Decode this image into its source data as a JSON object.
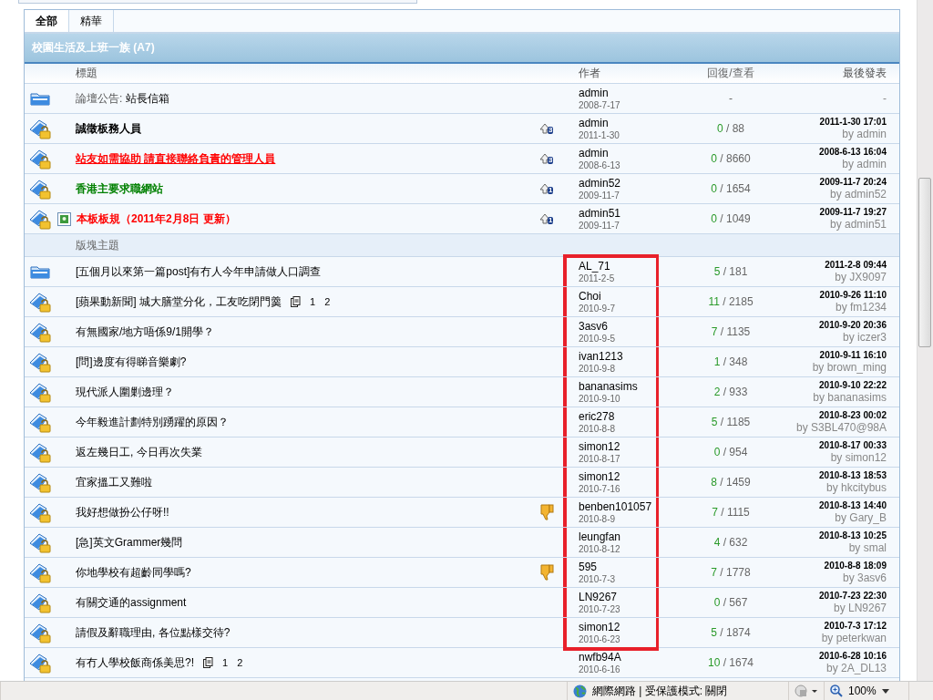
{
  "tabs": [
    {
      "label": "全部",
      "selected": true
    },
    {
      "label": "精華",
      "selected": false
    }
  ],
  "forum_title": "校園生活及上班一族 (A7)",
  "columns": {
    "title": "標題",
    "author": "作者",
    "replies": "回復/查看",
    "last_post": "最後發表"
  },
  "sticky": [
    {
      "kind": "announcement",
      "locked": false,
      "prefix": "論壇公告:",
      "title": "站長信箱",
      "bold": false,
      "underline": false,
      "image": false,
      "rated_down": false,
      "author": "admin",
      "date": "2008-7-17",
      "replies": "-",
      "last_by": "-"
    },
    {
      "kind": "topic",
      "locked": true,
      "title": "誠徵板務人員",
      "bold": true,
      "underline": false,
      "color": "#000000",
      "image": false,
      "stick_level": "3",
      "rated_down": false,
      "author": "admin",
      "date": "2011-1-30",
      "replies": "0",
      "views": "/ 88",
      "last_time": "2011-1-30 17:01",
      "last_by": "by admin"
    },
    {
      "kind": "topic",
      "locked": true,
      "title": "站友如需協助 請直接聯絡負責的管理人員",
      "bold": true,
      "underline": true,
      "color": "#ff0000",
      "image": false,
      "stick_level": "3",
      "rated_down": false,
      "author": "admin",
      "date": "2008-6-13",
      "replies": "0",
      "views": "/ 8660",
      "last_time": "2008-6-13 16:04",
      "last_by": "by admin"
    },
    {
      "kind": "topic",
      "locked": true,
      "title": "香港主要求職網站",
      "bold": true,
      "underline": false,
      "color": "#008000",
      "image": false,
      "stick_level": "1",
      "rated_down": false,
      "author": "admin52",
      "date": "2009-11-7",
      "replies": "0",
      "views": "/ 1654",
      "last_time": "2009-11-7 20:24",
      "last_by": "by admin52"
    },
    {
      "kind": "topic",
      "locked": true,
      "title": "本板板規（2011年2月8日 更新）",
      "bold": true,
      "underline": false,
      "color": "#ff0000",
      "image": true,
      "stick_level": "1",
      "rated_down": false,
      "author": "admin51",
      "date": "2009-11-7",
      "replies": "0",
      "views": "/ 1049",
      "last_time": "2009-11-7 19:27",
      "last_by": "by admin51"
    }
  ],
  "section_label": "版塊主題",
  "topics": [
    {
      "locked": false,
      "title": "[五個月以來第一篇post]有冇人今年申請做人口調查",
      "rated_down": false,
      "highlighted": true,
      "author": "AL_71",
      "date": "2011-2-5",
      "replies": "5",
      "views": "/ 181",
      "last_time": "2011-2-8 09:44",
      "last_by": "by JX9097"
    },
    {
      "locked": true,
      "title": "[蘋果動新聞] 城大膳堂分化，工友吃閉門羹",
      "pages": [
        "1",
        "2"
      ],
      "rated_down": false,
      "highlighted": true,
      "author": "Choi",
      "date": "2010-9-7",
      "replies": "11",
      "views": "/ 2185",
      "last_time": "2010-9-26 11:10",
      "last_by": "by fm1234"
    },
    {
      "locked": true,
      "title": "有無國家/地方唔係9/1開學？",
      "rated_down": false,
      "highlighted": true,
      "author": "3asv6",
      "date": "2010-9-5",
      "replies": "7",
      "views": "/ 1135",
      "last_time": "2010-9-20 20:36",
      "last_by": "by iczer3"
    },
    {
      "locked": true,
      "title": "[問]邊度有得睇音樂劇?",
      "rated_down": false,
      "highlighted": true,
      "author": "ivan1213",
      "date": "2010-9-8",
      "replies": "1",
      "views": "/ 348",
      "last_time": "2010-9-11 16:10",
      "last_by": "by brown_ming"
    },
    {
      "locked": true,
      "title": "現代派人圍剿邊理？",
      "rated_down": false,
      "highlighted": true,
      "author": "bananasims",
      "date": "2010-9-10",
      "replies": "2",
      "views": "/ 933",
      "last_time": "2010-9-10 22:22",
      "last_by": "by bananasims"
    },
    {
      "locked": true,
      "title": "今年毅進計劃特別踴躍的原因？",
      "rated_down": false,
      "highlighted": true,
      "author": "eric278",
      "date": "2010-8-8",
      "replies": "5",
      "views": "/ 1185",
      "last_time": "2010-8-23 00:02",
      "last_by": "by S3BL470@98A"
    },
    {
      "locked": true,
      "title": "返左幾日工, 今日再次失業",
      "rated_down": false,
      "highlighted": true,
      "author": "simon12",
      "date": "2010-8-17",
      "replies": "0",
      "views": "/ 954",
      "last_time": "2010-8-17 00:33",
      "last_by": "by simon12"
    },
    {
      "locked": true,
      "title": "宜家搵工又難啦",
      "rated_down": false,
      "highlighted": true,
      "author": "simon12",
      "date": "2010-7-16",
      "replies": "8",
      "views": "/ 1459",
      "last_time": "2010-8-13 18:53",
      "last_by": "by hkcitybus"
    },
    {
      "locked": true,
      "title": "我好想做扮公仔呀!!",
      "rated_down": true,
      "highlighted": true,
      "author": "benben101057",
      "date": "2010-8-9",
      "replies": "7",
      "views": "/ 1115",
      "last_time": "2010-8-13 14:40",
      "last_by": "by Gary_B"
    },
    {
      "locked": true,
      "title": "[急]英文Grammer幾問",
      "rated_down": false,
      "highlighted": true,
      "author": "leungfan",
      "date": "2010-8-12",
      "replies": "4",
      "views": "/ 632",
      "last_time": "2010-8-13 10:25",
      "last_by": "by smal"
    },
    {
      "locked": true,
      "title": "你地學校有超齡同學嗎?",
      "rated_down": true,
      "highlighted": true,
      "author": "595",
      "date": "2010-7-3",
      "replies": "7",
      "views": "/ 1778",
      "last_time": "2010-8-8 18:09",
      "last_by": "by 3asv6"
    },
    {
      "locked": true,
      "title": "有關交通的assignment",
      "rated_down": false,
      "highlighted": true,
      "author": "LN9267",
      "date": "2010-7-23",
      "replies": "0",
      "views": "/ 567",
      "last_time": "2010-7-23 22:30",
      "last_by": "by LN9267"
    },
    {
      "locked": true,
      "title": "請假及辭職理由, 各位點樣交待?",
      "rated_down": false,
      "highlighted": true,
      "author": "simon12",
      "date": "2010-6-23",
      "replies": "5",
      "views": "/ 1874",
      "last_time": "2010-7-3 17:12",
      "last_by": "by peterkwan"
    },
    {
      "locked": true,
      "title": "有冇人學校飯商係美思?!",
      "pages": [
        "1",
        "2"
      ],
      "rated_down": false,
      "highlighted": false,
      "author": "nwfb94A",
      "date": "2010-6-16",
      "replies": "10",
      "views": "/ 1674",
      "last_time": "2010-6-28 10:16",
      "last_by": "by 2A_DL13"
    }
  ],
  "status_bar": {
    "zone": "網際網路 | 受保護模式: 關閉",
    "zoom": "100%"
  }
}
